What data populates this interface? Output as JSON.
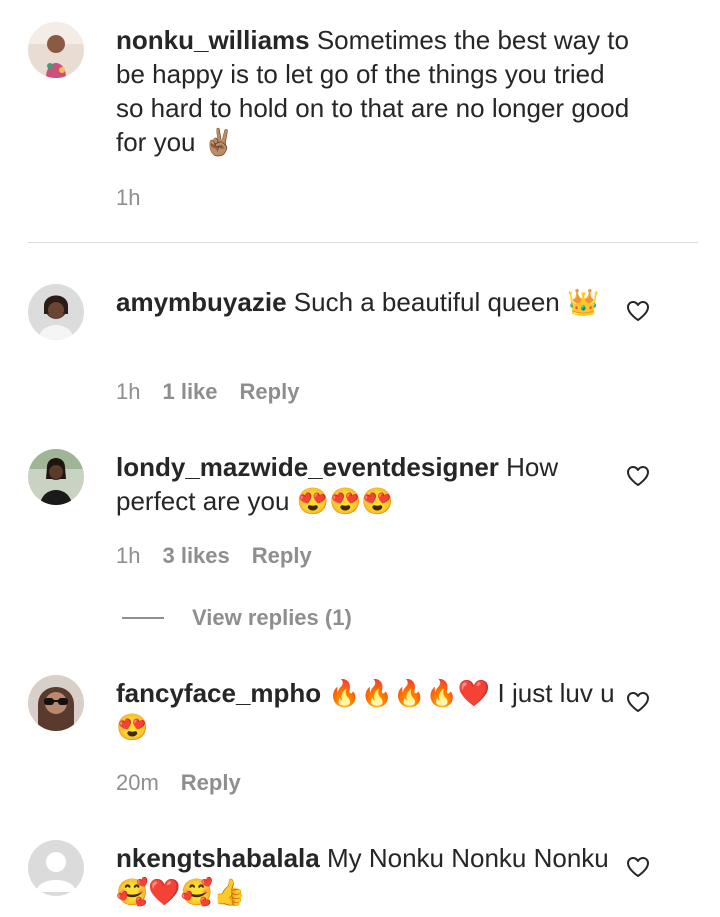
{
  "comments": [
    {
      "username": "nonku_williams",
      "text": "Sometimes the best way to be happy is to let go of the things you tried so hard to hold on to that are no longer good for you ✌🏽",
      "time": "1h",
      "avatar": "profile-photo"
    },
    {
      "username": "amymbuyazie",
      "text": "Such a beautiful queen 👑",
      "time": "1h",
      "likes": "1 like",
      "reply": "Reply",
      "avatar": "profile-photo"
    },
    {
      "username": "londy_mazwide_eventdesigner",
      "text": "How perfect are you 😍😍😍",
      "time": "1h",
      "likes": "3 likes",
      "reply": "Reply",
      "avatar": "profile-photo"
    },
    {
      "username": "fancyface_mpho",
      "text": "🔥🔥🔥🔥❤️ I just luv u 😍",
      "time": "20m",
      "reply": "Reply",
      "avatar": "profile-photo"
    },
    {
      "username": "nkengtshabalala",
      "text": "My Nonku Nonku Nonku 🥰❤️🥰👍",
      "avatar": "default-avatar"
    }
  ],
  "view_replies": "View replies (1)",
  "colors": {
    "text": "#262626",
    "secondary": "#8e8e8e",
    "divider": "#dbdbdb"
  },
  "icons": {
    "like": "heart-outline-icon"
  }
}
